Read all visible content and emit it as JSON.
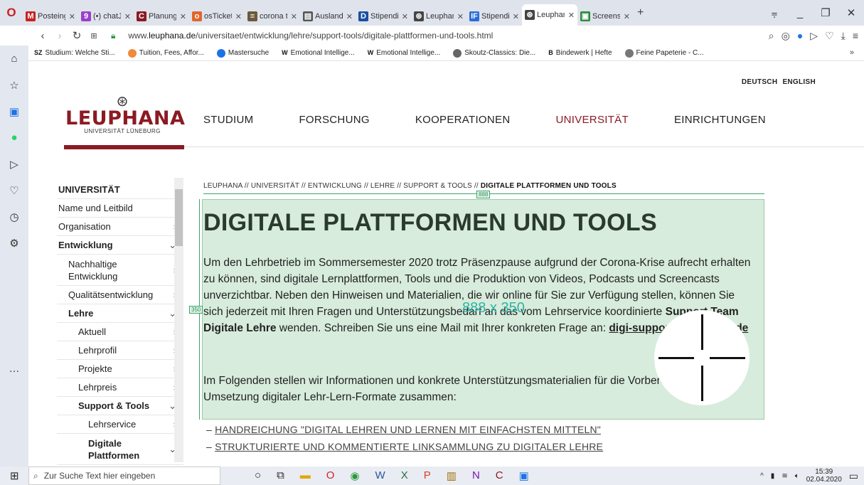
{
  "tabs": [
    {
      "label": "Posteing",
      "fav": "M",
      "color": "#c5221f"
    },
    {
      "label": "(•) chatJ",
      "fav": "9",
      "color": "#9b40c9"
    },
    {
      "label": "Planung",
      "fav": "C",
      "color": "#8b1a22"
    },
    {
      "label": "osTicket",
      "fav": "o",
      "color": "#e0662b"
    },
    {
      "label": "corona t",
      "fav": "≡",
      "color": "#6b5a3a"
    },
    {
      "label": "Auslands",
      "fav": "▤",
      "color": "#555"
    },
    {
      "label": "Stipendi",
      "fav": "D",
      "color": "#1a4fa0"
    },
    {
      "label": "Leuphan",
      "fav": "⊛",
      "color": "#444"
    },
    {
      "label": "Stipendi",
      "fav": "IF",
      "color": "#2b6cd8"
    },
    {
      "label": "Leuphan",
      "fav": "⊛",
      "color": "#444",
      "active": true
    },
    {
      "label": "Screensh",
      "fav": "▣",
      "color": "#2a8a3a"
    }
  ],
  "address": {
    "url_prefix": "www.",
    "url_domain": "leuphana.de",
    "url_path": "/universitaet/entwicklung/lehre/support-tools/digitale-plattformen-und-tools.html"
  },
  "bookmarks": [
    {
      "label": "Studium: Welche Sti...",
      "icon": "SZ",
      "color": "#111"
    },
    {
      "label": "Tuition, Fees, Affor...",
      "icon": "circle",
      "color": "#f08a3a"
    },
    {
      "label": "Mastersuche",
      "icon": "circle",
      "color": "#1a73e8"
    },
    {
      "label": "Emotional Intellige...",
      "icon": "W",
      "color": "#111"
    },
    {
      "label": "Emotional Intellige...",
      "icon": "W",
      "color": "#111"
    },
    {
      "label": "Skoutz-Classics: Die...",
      "icon": "person",
      "color": "#666"
    },
    {
      "label": "Bindewerk | Hefte",
      "icon": "B",
      "color": "#111"
    },
    {
      "label": "Feine Papeterie - C...",
      "icon": "shop",
      "color": "#777"
    }
  ],
  "site": {
    "lang_de": "DEUTSCH",
    "lang_en": "ENGLISH",
    "logo_name": "LEUPHANA",
    "logo_sub": "UNIVERSITÄT LÜNEBURG",
    "menu": [
      "STUDIUM",
      "FORSCHUNG",
      "KOOPERATIONEN",
      "UNIVERSITÄT",
      "EINRICHTUNGEN"
    ],
    "accent": "#8b1a22"
  },
  "subnav": [
    {
      "label": "UNIVERSITÄT",
      "level": 0,
      "bold": true,
      "chev": ""
    },
    {
      "label": "Name und Leitbild",
      "level": 0,
      "bold": false,
      "chev": ""
    },
    {
      "label": "Organisation",
      "level": 0,
      "bold": false,
      "chev": "›"
    },
    {
      "label": "Entwicklung",
      "level": 0,
      "bold": true,
      "chev": "⌄"
    },
    {
      "label": "Nachhaltige Entwicklung",
      "level": 1,
      "bold": false,
      "chev": "›"
    },
    {
      "label": "Qualitätsentwicklung",
      "level": 1,
      "bold": false,
      "chev": "›"
    },
    {
      "label": "Lehre",
      "level": 1,
      "bold": true,
      "chev": "⌄"
    },
    {
      "label": "Aktuell",
      "level": 2,
      "bold": false,
      "chev": "›"
    },
    {
      "label": "Lehrprofil",
      "level": 2,
      "bold": false,
      "chev": "›"
    },
    {
      "label": "Projekte",
      "level": 2,
      "bold": false,
      "chev": "›"
    },
    {
      "label": "Lehrpreis",
      "level": 2,
      "bold": false,
      "chev": "›"
    },
    {
      "label": "Support & Tools",
      "level": 2,
      "bold": true,
      "chev": "⌄"
    },
    {
      "label": "Lehrservice",
      "level": 3,
      "bold": false,
      "chev": "›"
    },
    {
      "label": "Digitale Plattformen",
      "level": 3,
      "bold": true,
      "chev": "⌄"
    }
  ],
  "content": {
    "breadcrumb": "LEUPHANA // UNIVERSITÄT // ENTWICKLUNG // LEHRE // SUPPORT & TOOLS // ",
    "breadcrumb_current": "DIGITALE PLATTFORMEN UND TOOLS",
    "title": "DIGITALE PLATTFORMEN UND TOOLS",
    "p1_a": "Um den Lehrbetrieb im Sommersemester 2020 trotz Präsenzpause aufgrund der Corona-Krise aufrecht erhalten zu können, sind digitale Lernplattformen, Tools und die Produktion von Videos, Podcasts und Screencasts unverzichtbar. Neben den Hinweisen und Materialien, die wir online für Sie zur Verfügung stellen, können Sie sich jederzeit mit Ihren Fragen und Unterstützungsbedarf an das vom Lehrservice koordinierte ",
    "p1_bold": "Support Team Digitale Lehre",
    "p1_b": " wenden. Schreiben Sie uns eine Mail mit Ihrer konkreten Frage an: ",
    "p1_mail": "digi-support@leuphana.de",
    "p2": "Im Folgenden stellen wir Informationen und konkrete Unterstützungsmaterialien für die Vorbereitung und die Umsetzung digitaler Lehr-Lern-Formate zusammen:",
    "link1": "HANDREICHUNG \"DIGITAL LEHREN UND LERNEN MIT EINFACHSTEN MITTELN\"",
    "link2": "STRUKTURIERTE UND KOMMENTIERTE LINKSAMMLUNG ZU DIGITALER LEHRE"
  },
  "measure": {
    "label": "888 x 350",
    "width_label": "888",
    "height_label": "350"
  },
  "taskbar": {
    "search_placeholder": "Zur Suche Text hier eingeben",
    "time": "15:39",
    "date": "02.04.2020"
  }
}
